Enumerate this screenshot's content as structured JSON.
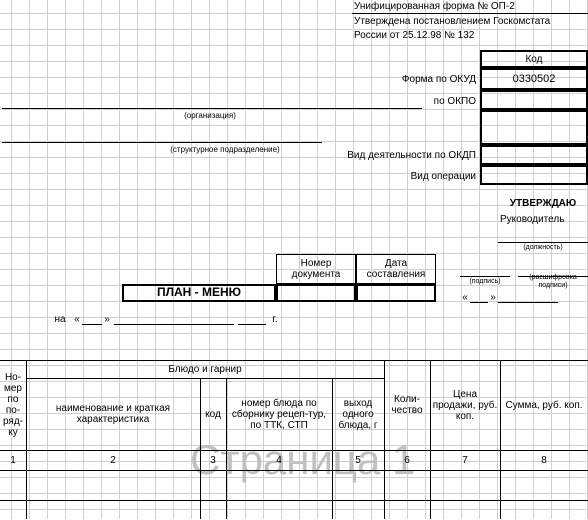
{
  "header": {
    "form_line": "Унифицированная форма № ОП-2",
    "approved_line": "Утверждена постановлением Госкомстата",
    "russia_line": "России от 25.12.98 № 132",
    "code_title": "Код",
    "okud_label": "Форма по ОКУД",
    "okud_value": "0330502",
    "okpo_label": "по ОКПО",
    "org_hint": "(организация)",
    "okdp_label": "Вид деятельности по ОКДП",
    "stru_hint": "(структурное подразделение)",
    "oper_label": "Вид операции",
    "approve": "УТВЕРЖДАЮ",
    "chief": "Руководитель",
    "post_hint": "(должность)",
    "sign_hint": "(подпись)",
    "decode_hint": "(расшифровка подписи)",
    "title": "ПЛАН - МЕНЮ",
    "docnum_label": "Номер документа",
    "date_label": "Дата составления",
    "na": "на",
    "g": "г.",
    "quote_open": "«",
    "quote_close": "»"
  },
  "table": {
    "col_no": "Но-мер по по-ряд-ку",
    "group": "Блюдо и гарнир",
    "col_name": "наименование и краткая характеристика",
    "col_code": "код",
    "col_recipe": "номер блюда по сборнику рецеп-тур, по ТТК, СТП",
    "col_yield": "выход одного блюда, г",
    "col_qty": "Коли-чество",
    "col_price": "Цена продажи, руб. коп.",
    "col_sum": "Сумма, руб. коп.",
    "nums": [
      "1",
      "2",
      "3",
      "4",
      "5",
      "6",
      "7",
      "8"
    ]
  },
  "watermark": "Страница 1"
}
